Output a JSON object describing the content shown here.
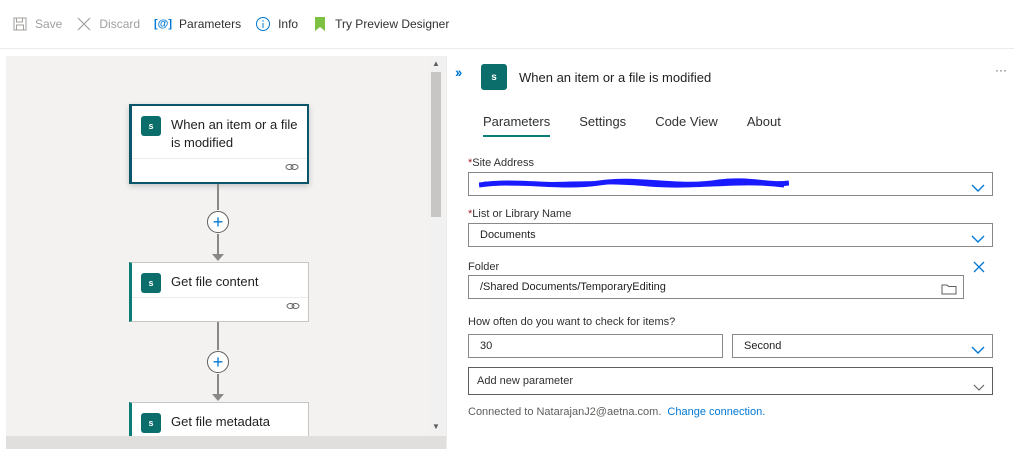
{
  "toolbar": {
    "save_label": "Save",
    "discard_label": "Discard",
    "parameters_label": "Parameters",
    "parameters_icon_text": "[@]",
    "info_label": "Info",
    "preview_label": "Try Preview Designer"
  },
  "canvas": {
    "cards": [
      {
        "title": "When an item or a file is modified",
        "selected": true
      },
      {
        "title": "Get file content",
        "selected": false
      },
      {
        "title": "Get file metadata",
        "selected": false
      }
    ],
    "logo_text": "s"
  },
  "panel": {
    "title": "When an item or a file is modified",
    "expand_glyph": "››",
    "more_glyph": "···",
    "tabs": [
      "Parameters",
      "Settings",
      "Code View",
      "About"
    ],
    "active_tab": "Parameters",
    "site_address_label": "Site Address",
    "site_address_value": "",
    "list_label": "List or Library Name",
    "list_value": "Documents",
    "folder_label": "Folder",
    "folder_value": "/Shared Documents/TemporaryEditing",
    "frequency_label": "How often do you want to check for items?",
    "interval_value": "30",
    "unit_value": "Second",
    "add_param_placeholder": "Add new parameter",
    "connected_text": "Connected to NatarajanJ2@aetna.com.",
    "change_connection_label": "Change connection."
  },
  "colors": {
    "accent": "#0078d4",
    "sharepoint": "#0b6e6b",
    "required": "#a4262c",
    "redaction": "#1a1aff"
  }
}
